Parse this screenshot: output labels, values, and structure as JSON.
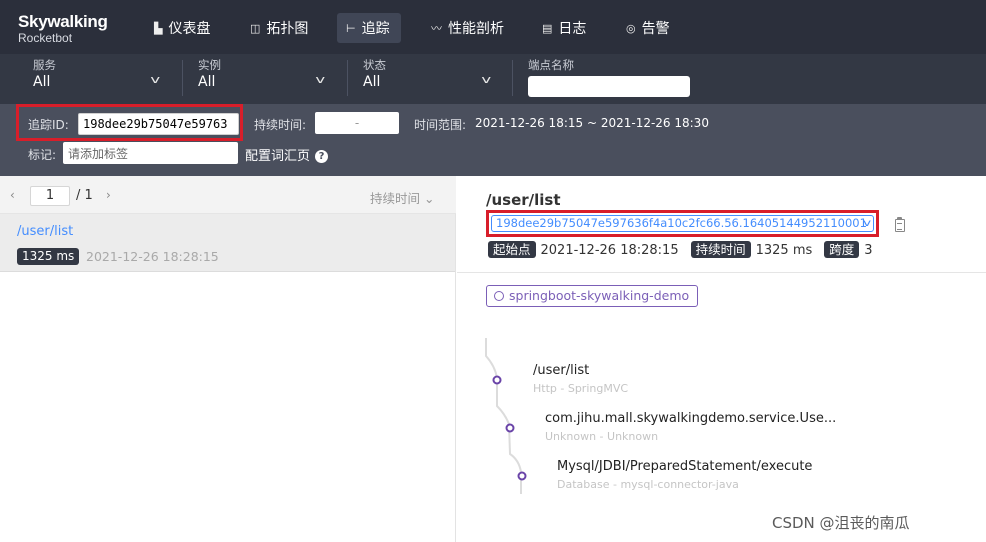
{
  "logo": {
    "line1": "Skywalking",
    "line2": "Rocketbot"
  },
  "nav": [
    {
      "icon": "dashboard-icon",
      "glyph": "▙",
      "label": "仪表盘"
    },
    {
      "icon": "topology-icon",
      "glyph": "◫",
      "label": "拓扑图"
    },
    {
      "icon": "trace-icon",
      "glyph": "⊢",
      "label": "追踪",
      "active": true
    },
    {
      "icon": "profile-icon",
      "glyph": "〰",
      "label": "性能剖析"
    },
    {
      "icon": "log-icon",
      "glyph": "▤",
      "label": "日志"
    },
    {
      "icon": "alarm-icon",
      "glyph": "◎",
      "label": "告警"
    }
  ],
  "filters": {
    "service": {
      "label": "服务",
      "value": "All"
    },
    "instance": {
      "label": "实例",
      "value": "All"
    },
    "status": {
      "label": "状态",
      "value": "All"
    },
    "endpoint": {
      "label": "端点名称",
      "value": ""
    }
  },
  "search": {
    "trace_id_label": "追踪ID:",
    "trace_id_value": "198dee29b75047e59763",
    "duration_label": "持续时间:",
    "duration_sep": "-",
    "time_range_label": "时间范围:",
    "time_range_value": "2021-12-26 18:15 ~ 2021-12-26 18:30",
    "tag_label": "标记:",
    "tag_placeholder": "请添加标签",
    "glossary_label": "配置词汇页",
    "help_glyph": "?"
  },
  "pager": {
    "page": "1",
    "total": "/ 1",
    "sort_label": "持续时间",
    "prev": "‹",
    "next": "›",
    "sort_glyph": "⌄"
  },
  "trace_list": [
    {
      "endpoint": "/user/list",
      "duration": "1325 ms",
      "start": "2021-12-26 18:28:15"
    }
  ],
  "detail": {
    "title": "/user/list",
    "trace_id": "198dee29b75047e597636f4a10c2fc66.56.16405144952110001",
    "start_label": "起始点",
    "start_value": "2021-12-26 18:28:15",
    "duration_label": "持续时间",
    "duration_value": "1325 ms",
    "span_label": "跨度",
    "span_value": "3",
    "service": "springboot-skywalking-demo",
    "spans": [
      {
        "name": "/user/list",
        "sub": "Http - SpringMVC"
      },
      {
        "name": "com.jihu.mall.skywalkingdemo.service.Use...",
        "sub": "Unknown - Unknown"
      },
      {
        "name": "Mysql/JDBI/PreparedStatement/execute",
        "sub": "Database - mysql-connector-java"
      }
    ]
  },
  "watermark": "CSDN @沮丧的南瓜",
  "colors": {
    "accent": "#448dfe",
    "highlight": "#d81e2a",
    "service": "#7b5fb7",
    "nav_bg": "#2b2f3b"
  }
}
